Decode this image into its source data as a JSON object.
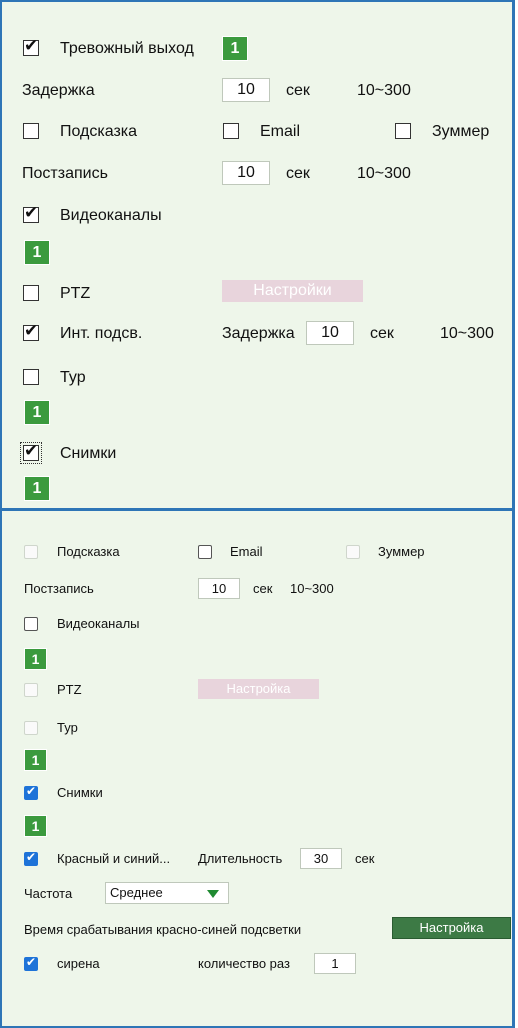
{
  "top": {
    "alarm_output": {
      "label": "Тревожный выход",
      "checked": true,
      "channel": "1"
    },
    "delay": {
      "label": "Задержка",
      "value": "10",
      "unit": "сек",
      "range": "10~300"
    },
    "hint": {
      "label": "Подсказка",
      "checked": false
    },
    "email": {
      "label": "Email",
      "checked": false
    },
    "buzzer": {
      "label": "Зуммер",
      "checked": false
    },
    "postrecord": {
      "label": "Постзапись",
      "value": "10",
      "unit": "сек",
      "range": "10~300"
    },
    "video_channels": {
      "label": "Видеоканалы",
      "checked": true,
      "channel": "1"
    },
    "ptz": {
      "label": "PTZ",
      "checked": false,
      "button": "Настройки"
    },
    "ir_light": {
      "label": "Инт. подсв.",
      "checked": true,
      "delay_label": "Задержка",
      "value": "10",
      "unit": "сек",
      "range": "10~300"
    },
    "tour": {
      "label": "Тур",
      "checked": false,
      "channel": "1"
    },
    "snapshots": {
      "label": "Снимки",
      "checked": true,
      "channel": "1"
    }
  },
  "bottom": {
    "hint": {
      "label": "Подсказка",
      "checked": false
    },
    "email": {
      "label": "Email",
      "checked": false
    },
    "buzzer": {
      "label": "Зуммер",
      "checked": false
    },
    "postrecord": {
      "label": "Постзапись",
      "value": "10",
      "unit": "сек",
      "range": "10~300"
    },
    "video_channels": {
      "label": "Видеоканалы",
      "checked": false,
      "channel": "1"
    },
    "ptz": {
      "label": "PTZ",
      "checked": false,
      "button": "Настройка"
    },
    "tour": {
      "label": "Тур",
      "checked": false,
      "channel": "1"
    },
    "snapshots": {
      "label": "Снимки",
      "checked": true,
      "channel": "1"
    },
    "red_blue": {
      "label": "Красный и синий...",
      "duration_label": "Длительность",
      "value": "30",
      "unit": "сек",
      "checked": true
    },
    "frequency": {
      "label": "Частота",
      "selected": "Среднее"
    },
    "red_blue_time": {
      "label": "Время срабатывания красно-синей подсветки",
      "button": "Настройка"
    },
    "siren": {
      "label": "сирена",
      "checked": true,
      "count_label": "количество раз",
      "value": "1"
    }
  },
  "colors": {
    "panel_bg": "#eef6ea",
    "border": "#2e75b6",
    "channel_green": "#3b9a3e",
    "checkbox_blue": "#1e73d8"
  }
}
